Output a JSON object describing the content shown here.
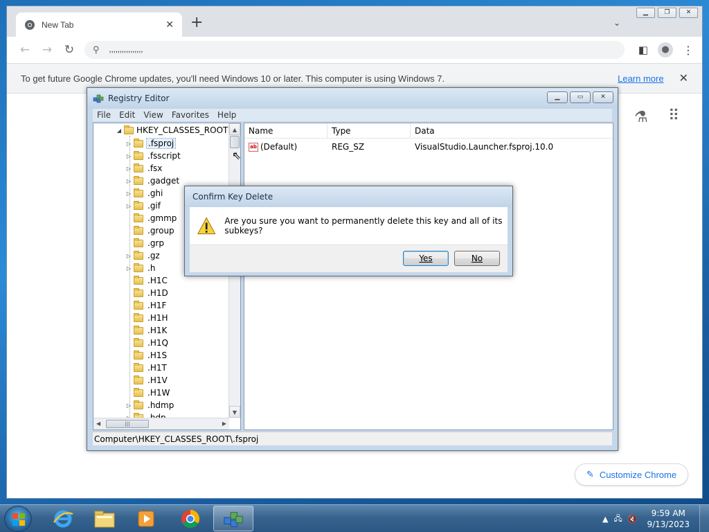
{
  "chrome": {
    "tab_title": "New Tab",
    "tab_close": "✕",
    "new_tab": "+",
    "tab_search": "⌄",
    "omnibox_text": ",,,,,,,,,,,,,,,,",
    "infobar_text": "To get future Google Chrome updates, you'll need Windows 10 or later. This computer is using Windows 7.",
    "learn_more": "Learn more",
    "infobar_close": "✕",
    "customize_label": "Customize Chrome",
    "accent_color": "#1a73e8"
  },
  "regedit": {
    "title": "Registry Editor",
    "menu": [
      "File",
      "Edit",
      "View",
      "Favorites",
      "Help"
    ],
    "tree_root": "HKEY_CLASSES_ROOT",
    "tree_items": [
      {
        "label": ".fsproj",
        "expandable": true,
        "selected": true
      },
      {
        "label": ".fsscript",
        "expandable": true
      },
      {
        "label": ".fsx",
        "expandable": true
      },
      {
        "label": ".gadget",
        "expandable": true
      },
      {
        "label": ".ghi",
        "expandable": true
      },
      {
        "label": ".gif",
        "expandable": true
      },
      {
        "label": ".gmmp",
        "expandable": false
      },
      {
        "label": ".group",
        "expandable": false
      },
      {
        "label": ".grp",
        "expandable": false
      },
      {
        "label": ".gz",
        "expandable": true
      },
      {
        "label": ".h",
        "expandable": true
      },
      {
        "label": ".H1C",
        "expandable": false
      },
      {
        "label": ".H1D",
        "expandable": false
      },
      {
        "label": ".H1F",
        "expandable": false
      },
      {
        "label": ".H1H",
        "expandable": false
      },
      {
        "label": ".H1K",
        "expandable": false
      },
      {
        "label": ".H1Q",
        "expandable": false
      },
      {
        "label": ".H1S",
        "expandable": false
      },
      {
        "label": ".H1T",
        "expandable": false
      },
      {
        "label": ".H1V",
        "expandable": false
      },
      {
        "label": ".H1W",
        "expandable": false
      },
      {
        "label": ".hdmp",
        "expandable": true
      },
      {
        "label": ".hdp",
        "expandable": true
      }
    ],
    "columns": {
      "name": "Name",
      "type": "Type",
      "data": "Data"
    },
    "values": [
      {
        "name": "(Default)",
        "type": "REG_SZ",
        "data": "VisualStudio.Launcher.fsproj.10.0"
      }
    ],
    "status_path": "Computer\\HKEY_CLASSES_ROOT\\.fsproj",
    "scroll_grip": "|||"
  },
  "dialog": {
    "title": "Confirm Key Delete",
    "message": "Are you sure you want to permanently delete this key and all of its subkeys?",
    "yes": "Yes",
    "no": "No"
  },
  "taskbar": {
    "time": "9:59 AM",
    "date": "9/13/2023",
    "apps": [
      "internet-explorer",
      "file-explorer",
      "media-player",
      "chrome",
      "registry-editor"
    ]
  }
}
